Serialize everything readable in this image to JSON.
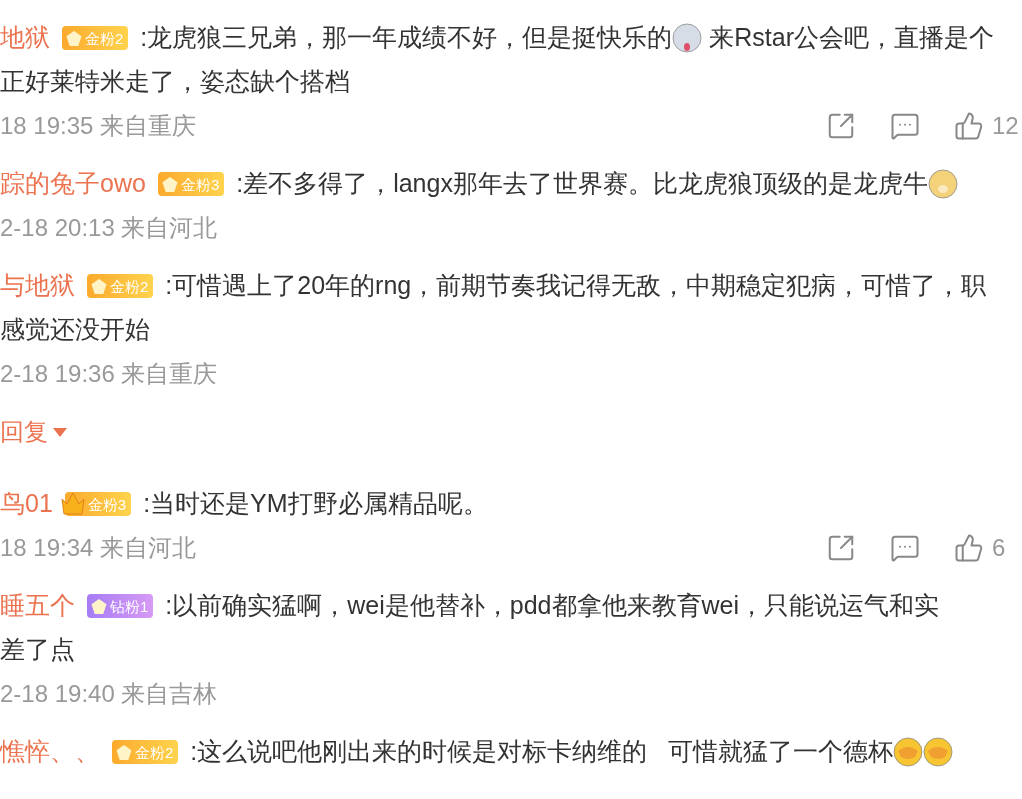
{
  "comments": [
    {
      "name": "地狱",
      "badge": {
        "kind": "gold",
        "label": "金粉2",
        "crown": false
      },
      "lines": [
        [
          {
            "kind": "text",
            "text": ":龙虎狼三兄弟，那一年成绩不好，但是挺快乐的"
          },
          {
            "kind": "husky"
          },
          {
            "kind": "text",
            "text": " 来Rstar公会吧，直播是个"
          }
        ],
        [
          {
            "kind": "text",
            "text": "正好莱特米走了，姿态缺个搭档"
          }
        ]
      ],
      "meta": "18 19:35 来自重庆",
      "likes": "12"
    },
    {
      "name": "踪的兔子owo",
      "badge": {
        "kind": "gold",
        "label": "金粉3",
        "crown": false
      },
      "lines": [
        [
          {
            "kind": "text",
            "text": ":差不多得了，langx那年去了世界赛。比龙虎狼顶级的是龙虎牛"
          },
          {
            "kind": "doge"
          }
        ]
      ],
      "meta": "2-18 20:13 来自河北"
    },
    {
      "name": "与地狱",
      "badge": {
        "kind": "gold",
        "label": "金粉2",
        "crown": false
      },
      "lines": [
        [
          {
            "kind": "text",
            "text": ":可惜遇上了20年的rng，前期节奏我记得无敌，中期稳定犯病，可惜了，职"
          }
        ],
        [
          {
            "kind": "text",
            "text": "感觉还没开始"
          }
        ]
      ],
      "meta": "2-18 19:36 来自重庆",
      "reply_toggle": {
        "label": "回复",
        "expanded": false
      }
    },
    {
      "name": "鸟01",
      "badge": {
        "kind": "gold",
        "label": "金粉3",
        "crown": true
      },
      "lines": [
        [
          {
            "kind": "text",
            "text": ":当时还是YM打野必属精品呢。"
          }
        ]
      ],
      "meta": "18 19:34 来自河北",
      "likes": "6"
    },
    {
      "name": "睡五个",
      "badge": {
        "kind": "diamond",
        "label": "钻粉1",
        "crown": false
      },
      "lines": [
        [
          {
            "kind": "text",
            "text": ":以前确实猛啊，wei是他替补，pdd都拿他来教育wei，只能说运气和实"
          }
        ],
        [
          {
            "kind": "text",
            "text": "差了点"
          }
        ]
      ],
      "meta": "2-18 19:40 来自吉林"
    },
    {
      "name": "憔悴、、",
      "badge": {
        "kind": "gold",
        "label": "金粉2",
        "crown": false
      },
      "lines": [
        [
          {
            "kind": "text",
            "text": ":这么说吧他刚出来的时候是对标卡纳维的   可惜就猛了一个德杯"
          },
          {
            "kind": "laugh"
          },
          {
            "kind": "laugh"
          }
        ]
      ]
    }
  ]
}
